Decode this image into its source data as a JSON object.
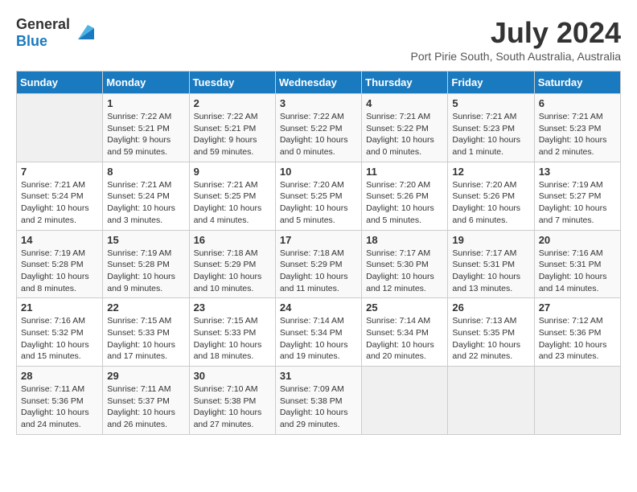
{
  "header": {
    "logo_general": "General",
    "logo_blue": "Blue",
    "month": "July 2024",
    "location": "Port Pirie South, South Australia, Australia"
  },
  "days_of_week": [
    "Sunday",
    "Monday",
    "Tuesday",
    "Wednesday",
    "Thursday",
    "Friday",
    "Saturday"
  ],
  "weeks": [
    [
      {
        "day": "",
        "info": ""
      },
      {
        "day": "1",
        "info": "Sunrise: 7:22 AM\nSunset: 5:21 PM\nDaylight: 9 hours\nand 59 minutes."
      },
      {
        "day": "2",
        "info": "Sunrise: 7:22 AM\nSunset: 5:21 PM\nDaylight: 9 hours\nand 59 minutes."
      },
      {
        "day": "3",
        "info": "Sunrise: 7:22 AM\nSunset: 5:22 PM\nDaylight: 10 hours\nand 0 minutes."
      },
      {
        "day": "4",
        "info": "Sunrise: 7:21 AM\nSunset: 5:22 PM\nDaylight: 10 hours\nand 0 minutes."
      },
      {
        "day": "5",
        "info": "Sunrise: 7:21 AM\nSunset: 5:23 PM\nDaylight: 10 hours\nand 1 minute."
      },
      {
        "day": "6",
        "info": "Sunrise: 7:21 AM\nSunset: 5:23 PM\nDaylight: 10 hours\nand 2 minutes."
      }
    ],
    [
      {
        "day": "7",
        "info": "Sunrise: 7:21 AM\nSunset: 5:24 PM\nDaylight: 10 hours\nand 2 minutes."
      },
      {
        "day": "8",
        "info": "Sunrise: 7:21 AM\nSunset: 5:24 PM\nDaylight: 10 hours\nand 3 minutes."
      },
      {
        "day": "9",
        "info": "Sunrise: 7:21 AM\nSunset: 5:25 PM\nDaylight: 10 hours\nand 4 minutes."
      },
      {
        "day": "10",
        "info": "Sunrise: 7:20 AM\nSunset: 5:25 PM\nDaylight: 10 hours\nand 5 minutes."
      },
      {
        "day": "11",
        "info": "Sunrise: 7:20 AM\nSunset: 5:26 PM\nDaylight: 10 hours\nand 5 minutes."
      },
      {
        "day": "12",
        "info": "Sunrise: 7:20 AM\nSunset: 5:26 PM\nDaylight: 10 hours\nand 6 minutes."
      },
      {
        "day": "13",
        "info": "Sunrise: 7:19 AM\nSunset: 5:27 PM\nDaylight: 10 hours\nand 7 minutes."
      }
    ],
    [
      {
        "day": "14",
        "info": "Sunrise: 7:19 AM\nSunset: 5:28 PM\nDaylight: 10 hours\nand 8 minutes."
      },
      {
        "day": "15",
        "info": "Sunrise: 7:19 AM\nSunset: 5:28 PM\nDaylight: 10 hours\nand 9 minutes."
      },
      {
        "day": "16",
        "info": "Sunrise: 7:18 AM\nSunset: 5:29 PM\nDaylight: 10 hours\nand 10 minutes."
      },
      {
        "day": "17",
        "info": "Sunrise: 7:18 AM\nSunset: 5:29 PM\nDaylight: 10 hours\nand 11 minutes."
      },
      {
        "day": "18",
        "info": "Sunrise: 7:17 AM\nSunset: 5:30 PM\nDaylight: 10 hours\nand 12 minutes."
      },
      {
        "day": "19",
        "info": "Sunrise: 7:17 AM\nSunset: 5:31 PM\nDaylight: 10 hours\nand 13 minutes."
      },
      {
        "day": "20",
        "info": "Sunrise: 7:16 AM\nSunset: 5:31 PM\nDaylight: 10 hours\nand 14 minutes."
      }
    ],
    [
      {
        "day": "21",
        "info": "Sunrise: 7:16 AM\nSunset: 5:32 PM\nDaylight: 10 hours\nand 15 minutes."
      },
      {
        "day": "22",
        "info": "Sunrise: 7:15 AM\nSunset: 5:33 PM\nDaylight: 10 hours\nand 17 minutes."
      },
      {
        "day": "23",
        "info": "Sunrise: 7:15 AM\nSunset: 5:33 PM\nDaylight: 10 hours\nand 18 minutes."
      },
      {
        "day": "24",
        "info": "Sunrise: 7:14 AM\nSunset: 5:34 PM\nDaylight: 10 hours\nand 19 minutes."
      },
      {
        "day": "25",
        "info": "Sunrise: 7:14 AM\nSunset: 5:34 PM\nDaylight: 10 hours\nand 20 minutes."
      },
      {
        "day": "26",
        "info": "Sunrise: 7:13 AM\nSunset: 5:35 PM\nDaylight: 10 hours\nand 22 minutes."
      },
      {
        "day": "27",
        "info": "Sunrise: 7:12 AM\nSunset: 5:36 PM\nDaylight: 10 hours\nand 23 minutes."
      }
    ],
    [
      {
        "day": "28",
        "info": "Sunrise: 7:11 AM\nSunset: 5:36 PM\nDaylight: 10 hours\nand 24 minutes."
      },
      {
        "day": "29",
        "info": "Sunrise: 7:11 AM\nSunset: 5:37 PM\nDaylight: 10 hours\nand 26 minutes."
      },
      {
        "day": "30",
        "info": "Sunrise: 7:10 AM\nSunset: 5:38 PM\nDaylight: 10 hours\nand 27 minutes."
      },
      {
        "day": "31",
        "info": "Sunrise: 7:09 AM\nSunset: 5:38 PM\nDaylight: 10 hours\nand 29 minutes."
      },
      {
        "day": "",
        "info": ""
      },
      {
        "day": "",
        "info": ""
      },
      {
        "day": "",
        "info": ""
      }
    ]
  ]
}
